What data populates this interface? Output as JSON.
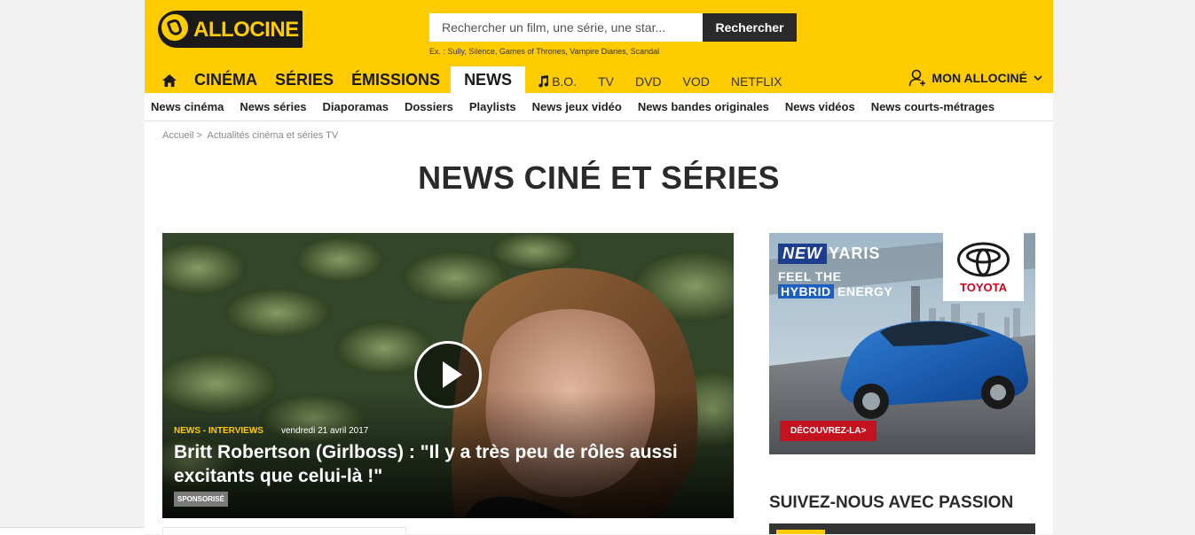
{
  "header": {
    "logo_text": "ALLOCINE",
    "search_placeholder": "Rechercher un film, une série, une star...",
    "search_button": "Rechercher",
    "search_examples": "Ex. : Sully, Silence, Games of Thrones, Vampire Diaries, Scandal",
    "account_label": "MON ALLOCINÉ"
  },
  "main_nav": {
    "major": [
      "CINÉMA",
      "SÉRIES",
      "ÉMISSIONS"
    ],
    "active": "NEWS",
    "minor": [
      "B.O.",
      "TV",
      "DVD",
      "VOD",
      "NETFLIX"
    ]
  },
  "sub_nav": [
    "News cinéma",
    "News séries",
    "Diaporamas",
    "Dossiers",
    "Playlists",
    "News jeux vidéo",
    "News bandes originales",
    "News vidéos",
    "News courts-métrages"
  ],
  "breadcrumb": {
    "home": "Accueil",
    "separator": ">",
    "current": "Actualités cinéma et séries TV"
  },
  "page_title": "NEWS CINÉ ET SÉRIES",
  "hero": {
    "category": "NEWS - INTERVIEWS",
    "date": "vendredi 21 avril 2017",
    "title": "Britt Robertson (Girlboss) : \"Il y a très peu de rôles aussi excitants que celui-là !\"",
    "badge": "SPONSORISÉ"
  },
  "ad": {
    "new": "NEW",
    "model": "YARIS",
    "tagline_1": "FEEL THE",
    "tagline_hybrid": "HYBRID",
    "tagline_energy": "ENERGY",
    "brand": "TOYOTA",
    "cta": "DÉCOUVREZ-LA>"
  },
  "follow_title": "SUIVEZ-NOUS AVEC PASSION",
  "colors": {
    "brand_yellow": "#fecc00",
    "dark": "#1a1a1a",
    "toyota_red": "#d4001a"
  }
}
